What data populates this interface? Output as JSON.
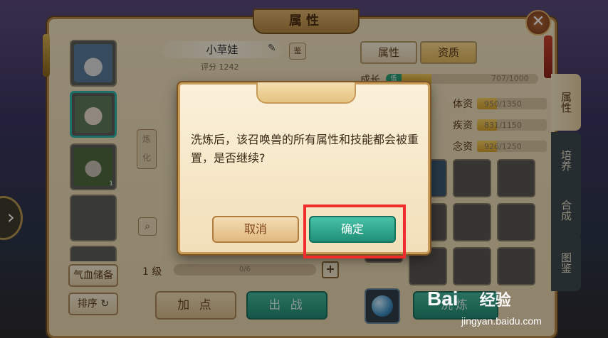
{
  "window": {
    "title": "属性",
    "close_glyph": "✕"
  },
  "pet": {
    "name": "小草娃",
    "score": "评分 1242",
    "small_button_label": "鉴"
  },
  "tabs_top": [
    {
      "label": "属性"
    },
    {
      "label": "资质"
    }
  ],
  "growth": {
    "label": "成长",
    "tag": "低",
    "value": "707/1000",
    "fraction": 0.707
  },
  "aptitudes": [
    {
      "label": "体资",
      "value": "950/1350",
      "fraction": 0.7
    },
    {
      "label": "疾资",
      "value": "831/1150",
      "fraction": 0.72
    },
    {
      "label": "念资",
      "value": "926/1250",
      "fraction": 0.74
    }
  ],
  "side_tabs": [
    {
      "label": "属性"
    },
    {
      "label": "培养"
    },
    {
      "label": "合成"
    },
    {
      "label": "图鉴"
    }
  ],
  "left_buttons": {
    "reserve": "气血储备",
    "sort": "排序",
    "sort_icon": "↻"
  },
  "pet_slots": [
    {
      "name": "pet-1",
      "level": ""
    },
    {
      "name": "pet-2",
      "level": ""
    },
    {
      "name": "pet-3",
      "level": "1"
    }
  ],
  "level_row": {
    "level": "1 级",
    "exp": "0/6",
    "plus": "+"
  },
  "bottom_buttons": {
    "add_points": "加 点",
    "battle": "出 战",
    "refine": "洗炼"
  },
  "left_nav_arrow": "›",
  "dialog": {
    "message": "洗炼后，该召唤兽的所有属性和技能都会被重置，是否继续?",
    "cancel_label": "取消",
    "confirm_label": "确定"
  },
  "watermark": {
    "brand": "Bai",
    "brand2": "经验",
    "url": "jingyan.baidu.com"
  },
  "colors": {
    "highlight": "#f02c2c",
    "confirm_green": "#1f9078"
  }
}
